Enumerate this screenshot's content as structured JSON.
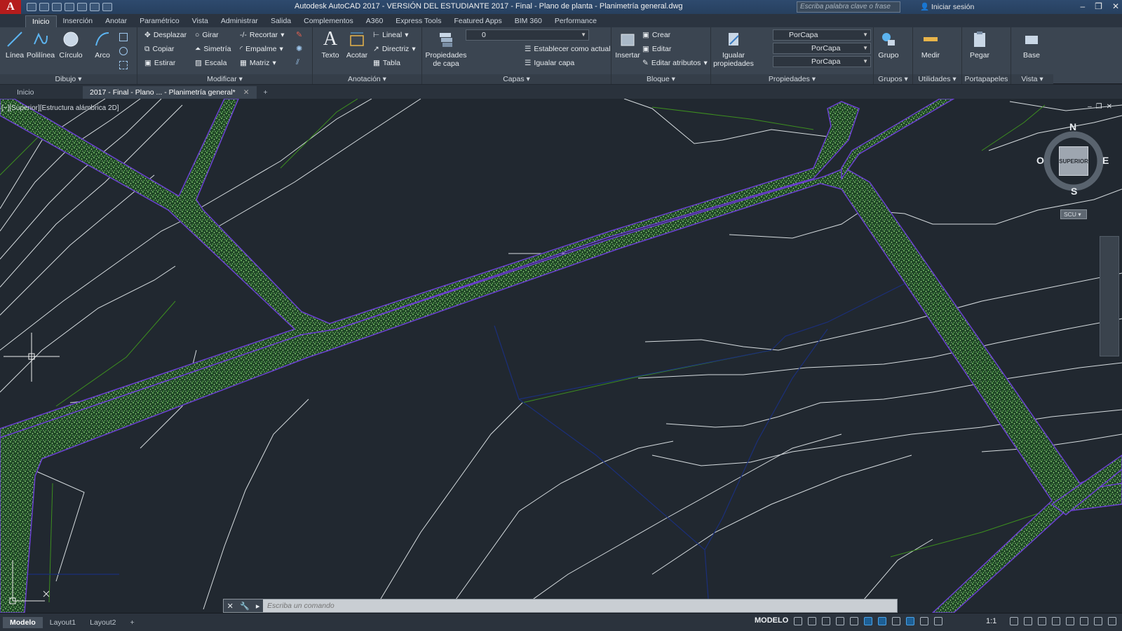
{
  "titlebar": {
    "logo": "A",
    "title": "Autodesk AutoCAD 2017 - VERSIÓN DEL ESTUDIANTE    2017 - Final - Plano de planta - Planimetría general.dwg",
    "search_placeholder": "Escriba palabra clave o frase",
    "signin": "Iniciar sesión"
  },
  "ribbon_tabs": [
    "Inicio",
    "Inserción",
    "Anotar",
    "Paramétrico",
    "Vista",
    "Administrar",
    "Salida",
    "Complementos",
    "A360",
    "Express Tools",
    "Featured Apps",
    "BIM 360",
    "Performance"
  ],
  "ribbon": {
    "dibujo": {
      "title": "Dibujo",
      "linea": "Línea",
      "polilinea": "Polilínea",
      "circulo": "Círculo",
      "arco": "Arco"
    },
    "modificar": {
      "title": "Modificar",
      "desplazar": "Desplazar",
      "girar": "Girar",
      "recortar": "Recortar",
      "copiar": "Copiar",
      "simetria": "Simetría",
      "empalme": "Empalme",
      "estirar": "Estirar",
      "escala": "Escala",
      "matriz": "Matriz"
    },
    "anotacion": {
      "title": "Anotación",
      "texto": "Texto",
      "acotar": "Acotar",
      "lineal": "Lineal",
      "directriz": "Directriz",
      "tabla": "Tabla"
    },
    "capas": {
      "title": "Capas",
      "propiedades_capa": "Propiedades de capa",
      "layer_value": "0",
      "establecer": "Establecer como actual",
      "igualar_capa": "Igualar capa"
    },
    "bloque": {
      "title": "Bloque",
      "insertar": "Insertar",
      "crear": "Crear",
      "editar": "Editar",
      "editar_atributos": "Editar atributos"
    },
    "propiedades": {
      "title": "Propiedades",
      "igualar": "Igualar propiedades",
      "color": "PorCapa",
      "linetype": "PorCapa",
      "lineweight": "PorCapa"
    },
    "grupos": {
      "title": "Grupos",
      "grupo": "Grupo"
    },
    "utilidades": {
      "title": "Utilidades",
      "medir": "Medir"
    },
    "portapapeles": {
      "title": "Portapapeles",
      "pegar": "Pegar"
    },
    "vista": {
      "title": "Vista",
      "base": "Base"
    }
  },
  "doc_tabs": [
    "Inicio",
    "2017 - Final - Plano ... - Planimetría general*"
  ],
  "viewport": {
    "label": "[−][Superior][Estructura alámbrica 2D]",
    "viewcube": {
      "n": "N",
      "s": "S",
      "e": "E",
      "o": "O",
      "face": "SUPERIOR",
      "wcs": "SCU"
    }
  },
  "command": {
    "placeholder": "Escriba un comando"
  },
  "layout_tabs": [
    "Modelo",
    "Layout1",
    "Layout2"
  ],
  "status": {
    "model": "MODELO",
    "scale": "1:1"
  },
  "colors": {
    "road_fill": "#1f5e2a",
    "road_edge": "#6a3fd1",
    "contour": "#d7dde0",
    "green_line": "#3d8f1f",
    "blue_line": "#1b2f7a",
    "background": "#212830"
  }
}
